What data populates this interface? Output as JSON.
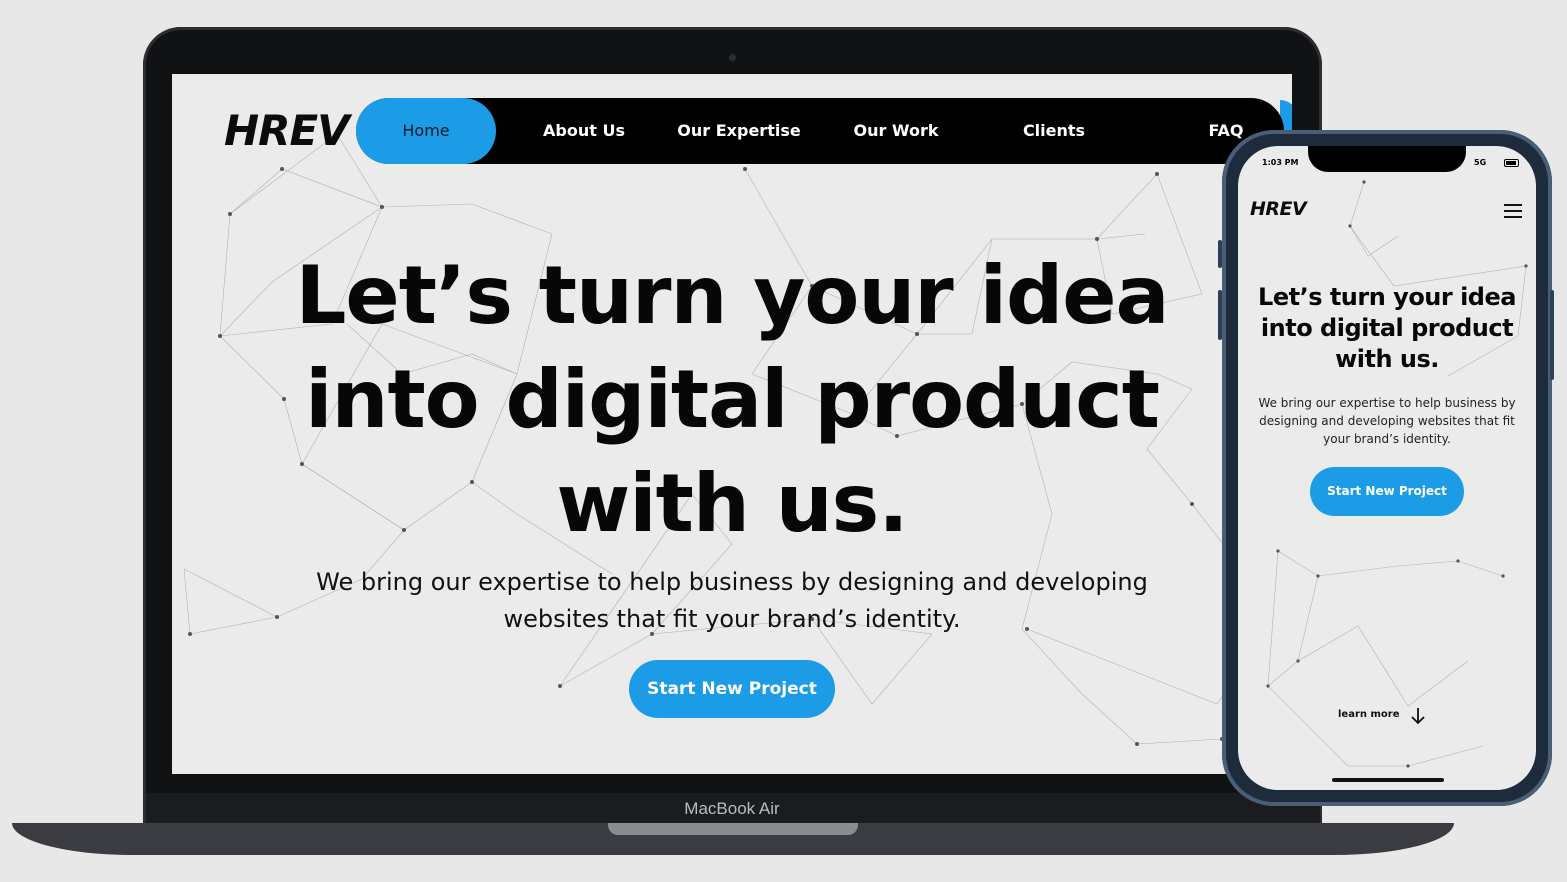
{
  "desktop": {
    "brand": "HREV",
    "nav": [
      "Home",
      "About Us",
      "Our Expertise",
      "Our Work",
      "Clients",
      "FAQ"
    ],
    "hero": {
      "title_line1": "Let’s turn your idea",
      "title_line2": "into digital product",
      "title_line3": "with us.",
      "subtitle_line1": "We bring our expertise to help business by designing and developing",
      "subtitle_line2": "websites that fit your brand’s identity.",
      "cta": "Start New Project"
    },
    "device_label": "MacBook Air"
  },
  "mobile": {
    "status_time": "1:03 PM",
    "status_network": "5G",
    "brand": "HREV",
    "hero": {
      "title_line1": "Let’s turn your idea",
      "title_line2": "into digital product",
      "title_line3": "with us.",
      "subtitle_line1": "We bring our expertise to help business by",
      "subtitle_line2": "designing and developing websites that fit",
      "subtitle_line3": "your brand’s identity.",
      "cta": "Start New Project"
    },
    "learn_more": "learn more"
  },
  "colors": {
    "accent": "#1c9be6",
    "nav_bg": "#000000",
    "page_bg": "#ebebeb",
    "text": "#070707"
  }
}
